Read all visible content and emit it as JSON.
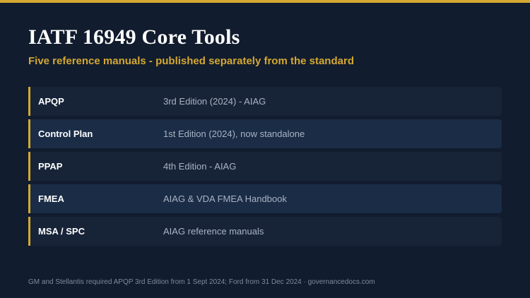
{
  "header": {
    "title": "IATF 16949 Core Tools",
    "subtitle": "Five reference manuals - published separately from the standard"
  },
  "tools": [
    {
      "name": "APQP",
      "detail": "3rd Edition (2024) - AIAG"
    },
    {
      "name": "Control Plan",
      "detail": "1st Edition (2024), now standalone"
    },
    {
      "name": "PPAP",
      "detail": "4th Edition - AIAG"
    },
    {
      "name": "FMEA",
      "detail": "AIAG & VDA FMEA Handbook"
    },
    {
      "name": "MSA / SPC",
      "detail": "AIAG reference manuals"
    }
  ],
  "footer": {
    "note": "GM and Stellantis required APQP 3rd Edition from 1 Sept 2024; Ford from 31 Dec 2024 · governancedocs.com"
  },
  "colors": {
    "background": "#111c2e",
    "accent": "#d4a832",
    "row": "#172438",
    "row_alt": "#1a2c46"
  }
}
